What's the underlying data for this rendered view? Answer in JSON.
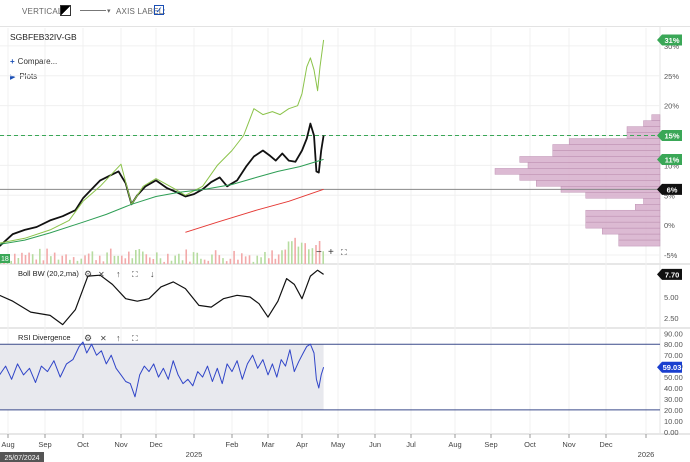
{
  "toolbar": {
    "vertical_label": "VERTICAL:",
    "axis_label_label": "AXIS LABEL:",
    "axis_label_checked": true
  },
  "main_panel": {
    "symbol": "SGBFEB32IV-GB",
    "compare_label": "Compare...",
    "plots_label": "Plots",
    "volume_tag": "18"
  },
  "colors": {
    "price": "#111111",
    "green_line": "#8bc34a",
    "ma_line": "#2e9e55",
    "red_line": "#e53935",
    "histogram": "#d9b3cf",
    "histogram_border": "#b98aad",
    "tag_green": "#3aa757",
    "tag_black": "#111111",
    "tag_blue": "#1a3fcf",
    "rsi_line": "#3045c8"
  },
  "icons": [
    "gear-icon",
    "up-arrow-icon",
    "expand-icon",
    "down-arrow-icon",
    "minus-icon",
    "plus-icon"
  ],
  "chart_data": [
    {
      "type": "line",
      "title": "SGBFEB32IV-GB",
      "y_unit": "%",
      "ylim": [
        -5,
        31
      ],
      "y_ticks": [
        "-5%",
        "0%",
        "5%",
        "10%",
        "15%",
        "20%",
        "25%",
        "30%"
      ],
      "x_ticks": [
        "Aug",
        "Sep",
        "Oct",
        "Nov",
        "Dec",
        "2025",
        "Feb",
        "Mar",
        "Apr",
        "May",
        "Jun",
        "Jul",
        "Aug",
        "Sep",
        "Oct",
        "Nov",
        "Dec",
        "2026"
      ],
      "x_range": [
        "2024-07-25",
        "2026-01-10"
      ],
      "cursor_date": "25/07/2024",
      "grid": true,
      "legend": "none",
      "value_tags": [
        {
          "label": "31%",
          "value": 31,
          "style": "green"
        },
        {
          "label": "15%",
          "value": 15,
          "style": "green"
        },
        {
          "label": "11%",
          "value": 11,
          "style": "green"
        },
        {
          "label": "6%",
          "value": 6,
          "style": "black"
        }
      ],
      "reference_lines": [
        {
          "value": 15,
          "style": "dashed",
          "color": "#3aa757"
        },
        {
          "value": 6,
          "style": "solid",
          "color": "#888888"
        }
      ],
      "series": [
        {
          "name": "SGBFEB32IV-GB",
          "color": "#111111",
          "points": [
            [
              "2024-07-25",
              -3.5
            ],
            [
              "2024-08-05",
              -1.5
            ],
            [
              "2024-08-15",
              -0.8
            ],
            [
              "2024-08-25",
              -0.3
            ],
            [
              "2024-09-05",
              0.8
            ],
            [
              "2024-09-15",
              1.5
            ],
            [
              "2024-09-25",
              2.5
            ],
            [
              "2024-10-01",
              4.5
            ],
            [
              "2024-10-08",
              6
            ],
            [
              "2024-10-15",
              7.5
            ],
            [
              "2024-10-22",
              8.2
            ],
            [
              "2024-10-30",
              9
            ],
            [
              "2024-11-05",
              7
            ],
            [
              "2024-11-10",
              3.5
            ],
            [
              "2024-11-15",
              5
            ],
            [
              "2024-11-22",
              6.5
            ],
            [
              "2024-12-01",
              7.5
            ],
            [
              "2024-12-10",
              6.2
            ],
            [
              "2024-12-18",
              5.5
            ],
            [
              "2024-12-25",
              4.8
            ],
            [
              "2025-01-01",
              5.2
            ],
            [
              "2025-01-08",
              6
            ],
            [
              "2025-01-15",
              7.2
            ],
            [
              "2025-01-22",
              8
            ],
            [
              "2025-01-28",
              6.5
            ],
            [
              "2025-02-05",
              7.5
            ],
            [
              "2025-02-12",
              9.8
            ],
            [
              "2025-02-18",
              11.5
            ],
            [
              "2025-02-25",
              12.5
            ],
            [
              "2025-03-03",
              11.6
            ],
            [
              "2025-03-08",
              10.8
            ],
            [
              "2025-03-14",
              12
            ],
            [
              "2025-03-20",
              10.8
            ],
            [
              "2025-03-26",
              10.6
            ],
            [
              "2025-04-01",
              12.5
            ],
            [
              "2025-04-05",
              14.5
            ],
            [
              "2025-04-08",
              17
            ],
            [
              "2025-04-11",
              15
            ],
            [
              "2025-04-13",
              9
            ],
            [
              "2025-04-15",
              8.8
            ],
            [
              "2025-04-17",
              12.5
            ],
            [
              "2025-04-19",
              15
            ]
          ]
        },
        {
          "name": "",
          "color": "#8bc34a",
          "points": [
            [
              "2024-07-25",
              -3
            ],
            [
              "2024-08-15",
              -2.2
            ],
            [
              "2024-09-05",
              -0.8
            ],
            [
              "2024-09-20",
              0.8
            ],
            [
              "2024-10-01",
              4
            ],
            [
              "2024-10-15",
              6.5
            ],
            [
              "2024-11-01",
              10.2
            ],
            [
              "2024-11-10",
              3.5
            ],
            [
              "2024-11-20",
              6.5
            ],
            [
              "2024-12-01",
              7.8
            ],
            [
              "2024-12-15",
              6.2
            ],
            [
              "2024-12-25",
              5
            ],
            [
              "2025-01-08",
              6.5
            ],
            [
              "2025-01-20",
              10
            ],
            [
              "2025-02-01",
              12.5
            ],
            [
              "2025-02-10",
              15
            ],
            [
              "2025-02-18",
              19.5
            ],
            [
              "2025-02-25",
              18.5
            ],
            [
              "2025-03-05",
              19
            ],
            [
              "2025-03-12",
              18.5
            ],
            [
              "2025-03-20",
              19.5
            ],
            [
              "2025-03-28",
              20
            ],
            [
              "2025-04-01",
              22
            ],
            [
              "2025-04-05",
              26.5
            ],
            [
              "2025-04-08",
              28
            ],
            [
              "2025-04-11",
              26
            ],
            [
              "2025-04-14",
              22.5
            ],
            [
              "2025-04-16",
              26.5
            ],
            [
              "2025-04-19",
              31
            ]
          ]
        },
        {
          "name": "",
          "color": "#2e9e55",
          "points": [
            [
              "2024-07-25",
              -3.2
            ],
            [
              "2024-08-15",
              -2.5
            ],
            [
              "2024-09-05",
              -1.3
            ],
            [
              "2024-10-01",
              0.5
            ],
            [
              "2024-10-20",
              1.8
            ],
            [
              "2024-11-10",
              3.5
            ],
            [
              "2024-12-01",
              4.8
            ],
            [
              "2024-12-20",
              5.5
            ],
            [
              "2025-01-10",
              6
            ],
            [
              "2025-02-01",
              6.8
            ],
            [
              "2025-02-20",
              8
            ],
            [
              "2025-03-10",
              9
            ],
            [
              "2025-03-30",
              9.8
            ],
            [
              "2025-04-19",
              11
            ]
          ]
        },
        {
          "name": "",
          "color": "#e53935",
          "points": [
            [
              "2024-12-25",
              -1.2
            ],
            [
              "2025-01-20",
              0.5
            ],
            [
              "2025-02-20",
              2.5
            ],
            [
              "2025-03-20",
              4
            ],
            [
              "2025-04-19",
              6
            ]
          ]
        }
      ],
      "volume_histogram": {
        "price_levels": [
          18,
          17,
          16,
          15,
          14,
          13,
          12,
          11,
          10,
          9,
          8,
          7,
          6,
          5,
          4,
          3,
          2,
          1,
          0,
          -1,
          -2,
          -3
        ],
        "volumes": [
          10,
          20,
          40,
          40,
          110,
          130,
          130,
          170,
          160,
          200,
          170,
          150,
          120,
          90,
          20,
          30,
          90,
          90,
          90,
          70,
          50,
          50
        ]
      }
    },
    {
      "type": "line",
      "title": "Boll BW (20,2,ma)",
      "ylim": [
        1.5,
        8.5
      ],
      "y_ticks": [
        "2.50",
        "5.00",
        "7.50"
      ],
      "value_tags": [
        {
          "label": "7.70",
          "value": 7.7,
          "style": "black"
        }
      ],
      "series": [
        {
          "name": "Boll BW (20,2,ma)",
          "color": "#111111",
          "points": [
            [
              "2024-07-25",
              5.2
            ],
            [
              "2024-08-05",
              4.5
            ],
            [
              "2024-08-20",
              3.2
            ],
            [
              "2024-09-05",
              2.8
            ],
            [
              "2024-09-15",
              1.7
            ],
            [
              "2024-09-25",
              3.5
            ],
            [
              "2024-10-05",
              7.5
            ],
            [
              "2024-10-15",
              7.6
            ],
            [
              "2024-10-25",
              6.5
            ],
            [
              "2024-11-05",
              4.8
            ],
            [
              "2024-11-15",
              4.5
            ],
            [
              "2024-11-25",
              4.8
            ],
            [
              "2024-12-05",
              6.2
            ],
            [
              "2024-12-15",
              6.8
            ],
            [
              "2024-12-25",
              6
            ],
            [
              "2025-01-05",
              4
            ],
            [
              "2025-01-15",
              3.8
            ],
            [
              "2025-01-25",
              4.8
            ],
            [
              "2025-02-05",
              5.2
            ],
            [
              "2025-02-15",
              5
            ],
            [
              "2025-02-22",
              4.2
            ],
            [
              "2025-03-01",
              2.6
            ],
            [
              "2025-03-10",
              4.5
            ],
            [
              "2025-03-18",
              7.2
            ],
            [
              "2025-03-25",
              6.5
            ],
            [
              "2025-04-01",
              4.8
            ],
            [
              "2025-04-08",
              7.5
            ],
            [
              "2025-04-14",
              8.2
            ],
            [
              "2025-04-19",
              7.7
            ]
          ]
        }
      ]
    },
    {
      "type": "line",
      "title": "RSI Divergence",
      "ylim": [
        0,
        90
      ],
      "y_ticks": [
        "0.00",
        "10.00",
        "20.00",
        "30.00",
        "40.00",
        "50.00",
        "60.00",
        "70.00",
        "80.00",
        "90.00"
      ],
      "bands": [
        20,
        80
      ],
      "value_tags": [
        {
          "label": "59.03",
          "value": 59.03,
          "style": "blue"
        }
      ],
      "series": [
        {
          "name": "RSI Divergence",
          "color": "#3045c8",
          "points": [
            [
              "2024-07-25",
              52
            ],
            [
              "2024-07-30",
              60
            ],
            [
              "2024-08-04",
              48
            ],
            [
              "2024-08-09",
              62
            ],
            [
              "2024-08-14",
              52
            ],
            [
              "2024-08-19",
              58
            ],
            [
              "2024-08-24",
              45
            ],
            [
              "2024-08-29",
              60
            ],
            [
              "2024-09-03",
              55
            ],
            [
              "2024-09-08",
              65
            ],
            [
              "2024-09-13",
              50
            ],
            [
              "2024-09-18",
              62
            ],
            [
              "2024-09-23",
              66
            ],
            [
              "2024-09-28",
              78
            ],
            [
              "2024-10-01",
              82
            ],
            [
              "2024-10-04",
              72
            ],
            [
              "2024-10-08",
              80
            ],
            [
              "2024-10-12",
              70
            ],
            [
              "2024-10-16",
              74
            ],
            [
              "2024-10-20",
              62
            ],
            [
              "2024-10-24",
              70
            ],
            [
              "2024-10-28",
              58
            ],
            [
              "2024-11-01",
              52
            ],
            [
              "2024-11-05",
              46
            ],
            [
              "2024-11-09",
              44
            ],
            [
              "2024-11-13",
              32
            ],
            [
              "2024-11-17",
              52
            ],
            [
              "2024-11-21",
              60
            ],
            [
              "2024-11-25",
              55
            ],
            [
              "2024-11-29",
              62
            ],
            [
              "2024-12-03",
              50
            ],
            [
              "2024-12-07",
              58
            ],
            [
              "2024-12-11",
              48
            ],
            [
              "2024-12-15",
              65
            ],
            [
              "2024-12-19",
              52
            ],
            [
              "2024-12-23",
              44
            ],
            [
              "2024-12-27",
              48
            ],
            [
              "2024-12-31",
              42
            ],
            [
              "2025-01-04",
              55
            ],
            [
              "2025-01-08",
              50
            ],
            [
              "2025-01-12",
              60
            ],
            [
              "2025-01-16",
              46
            ],
            [
              "2025-01-20",
              58
            ],
            [
              "2025-01-24",
              44
            ],
            [
              "2025-01-28",
              62
            ],
            [
              "2025-02-01",
              55
            ],
            [
              "2025-02-05",
              65
            ],
            [
              "2025-02-09",
              48
            ],
            [
              "2025-02-13",
              62
            ],
            [
              "2025-02-17",
              70
            ],
            [
              "2025-02-21",
              58
            ],
            [
              "2025-02-25",
              66
            ],
            [
              "2025-03-01",
              52
            ],
            [
              "2025-03-05",
              62
            ],
            [
              "2025-03-09",
              50
            ],
            [
              "2025-03-13",
              66
            ],
            [
              "2025-03-17",
              60
            ],
            [
              "2025-03-21",
              75
            ],
            [
              "2025-03-25",
              55
            ],
            [
              "2025-03-29",
              64
            ],
            [
              "2025-04-02",
              72
            ],
            [
              "2025-04-05",
              78
            ],
            [
              "2025-04-08",
              80
            ],
            [
              "2025-04-11",
              72
            ],
            [
              "2025-04-13",
              48
            ],
            [
              "2025-04-15",
              40
            ],
            [
              "2025-04-17",
              52
            ],
            [
              "2025-04-19",
              59
            ]
          ]
        }
      ]
    }
  ]
}
